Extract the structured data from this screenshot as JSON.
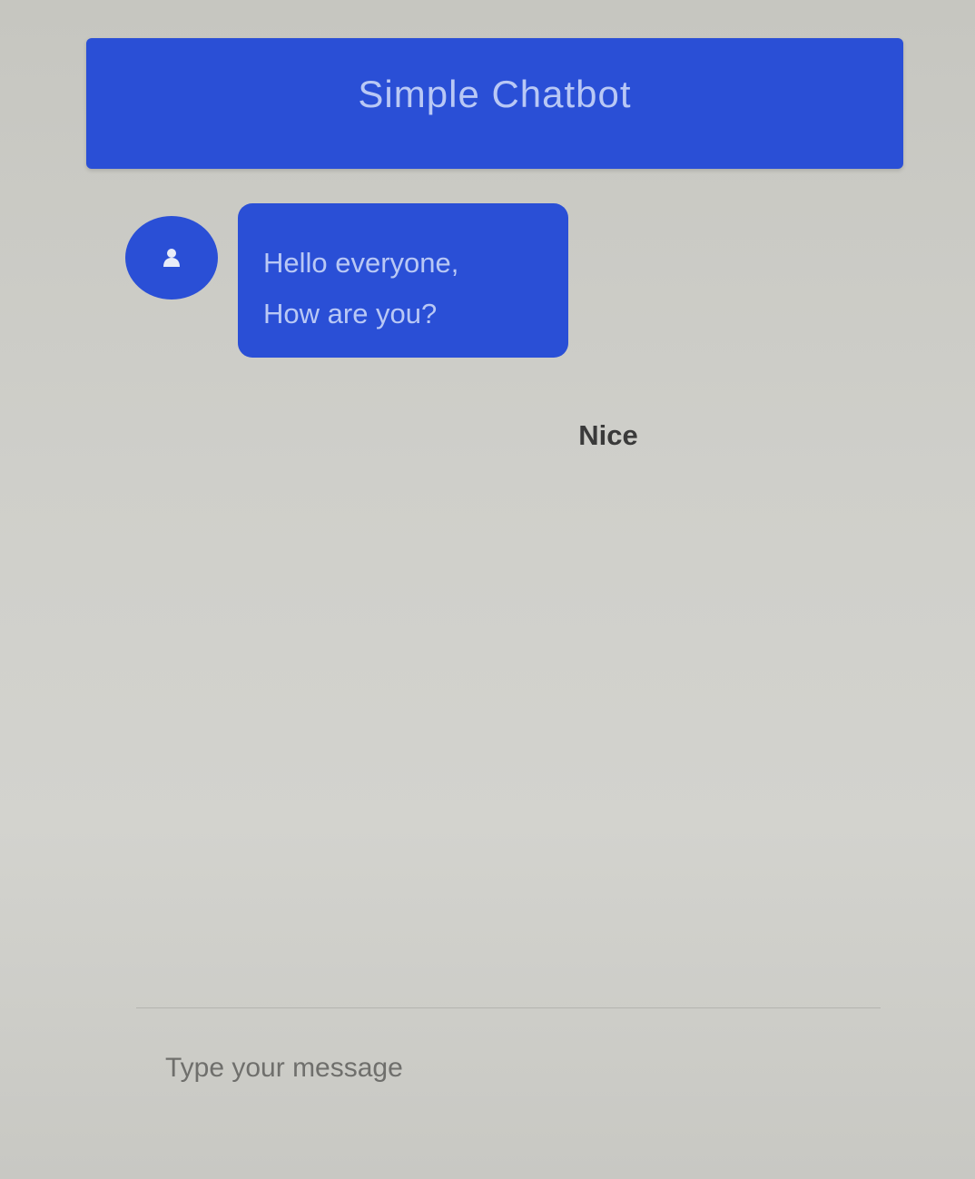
{
  "header": {
    "title": "Simple Chatbot"
  },
  "messages": [
    {
      "sender": "bot",
      "lines": [
        "Hello everyone,",
        "How are you?"
      ]
    },
    {
      "sender": "user",
      "text": "Nice"
    }
  ],
  "composer": {
    "placeholder": "Type your message"
  },
  "colors": {
    "accent": "#2a4fd6",
    "accent_text": "#b9c8f5",
    "background": "#cdcdc8"
  },
  "icons": {
    "avatar": "user-icon"
  }
}
